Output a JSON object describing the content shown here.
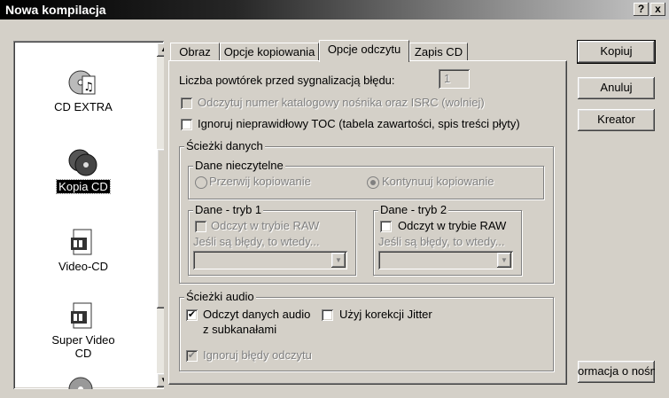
{
  "window": {
    "title": "Nowa kompilacja",
    "help_button": "?",
    "close_button": "x"
  },
  "project_list": {
    "items": [
      {
        "label": "CD EXTRA",
        "icon": "music-disc-icon"
      },
      {
        "label": "Kopia CD",
        "icon": "disc-copy-icon",
        "selected": true
      },
      {
        "label": "Video-CD",
        "icon": "film-disc-icon"
      },
      {
        "label": "Super Video CD",
        "icon": "film-disc-icon"
      },
      {
        "label": "",
        "icon": "disc-icon"
      }
    ]
  },
  "tabs": [
    {
      "label": "Obraz"
    },
    {
      "label": "Opcje kopiowania"
    },
    {
      "label": "Opcje odczytu",
      "active": true
    },
    {
      "label": "Zapis CD"
    }
  ],
  "read_options": {
    "retries_label": "Liczba powtórek przed sygnalizacją błędu:",
    "retries_value": "1",
    "read_isrc": {
      "label": "Odczytuj numer katalogowy nośnika oraz ISRC (wolniej)",
      "checked": false,
      "enabled": false
    },
    "ignore_toc": {
      "label": "Ignoruj nieprawidłowy TOC (tabela zawartości, spis treści płyty)",
      "checked": false,
      "enabled": true
    }
  },
  "data_tracks": {
    "title": "Ścieżki danych",
    "unreadable": {
      "title": "Dane nieczytelne",
      "options": [
        {
          "label": "Przerwij kopiowanie",
          "selected": false
        },
        {
          "label": "Kontynuuj kopiowanie",
          "selected": true
        }
      ]
    },
    "mode1": {
      "title": "Dane - tryb 1",
      "raw_label": "Odczyt w trybie RAW",
      "raw_checked": false,
      "raw_enabled": false,
      "on_error_label": "Jeśli są błędy, to wtedy...",
      "on_error_value": ""
    },
    "mode2": {
      "title": "Dane - tryb 2",
      "raw_label": "Odczyt w trybie RAW",
      "raw_checked": false,
      "raw_enabled": true,
      "on_error_label": "Jeśli są błędy, to wtedy...",
      "on_error_value": ""
    }
  },
  "audio_tracks": {
    "title": "Ścieżki audio",
    "read_subchannel": {
      "label_line1": "Odczyt danych audio",
      "label_line2": "z subkanałami",
      "checked": true
    },
    "jitter": {
      "label": "Użyj korekcji Jitter",
      "checked": false
    },
    "ignore_errors": {
      "label": "Ignoruj błędy odczytu",
      "checked": true,
      "enabled": false
    }
  },
  "buttons": {
    "copy": "Kopiuj",
    "cancel": "Anuluj",
    "wizard": "Kreator",
    "info": "ormacja o nośni"
  },
  "check_mark": "✔"
}
